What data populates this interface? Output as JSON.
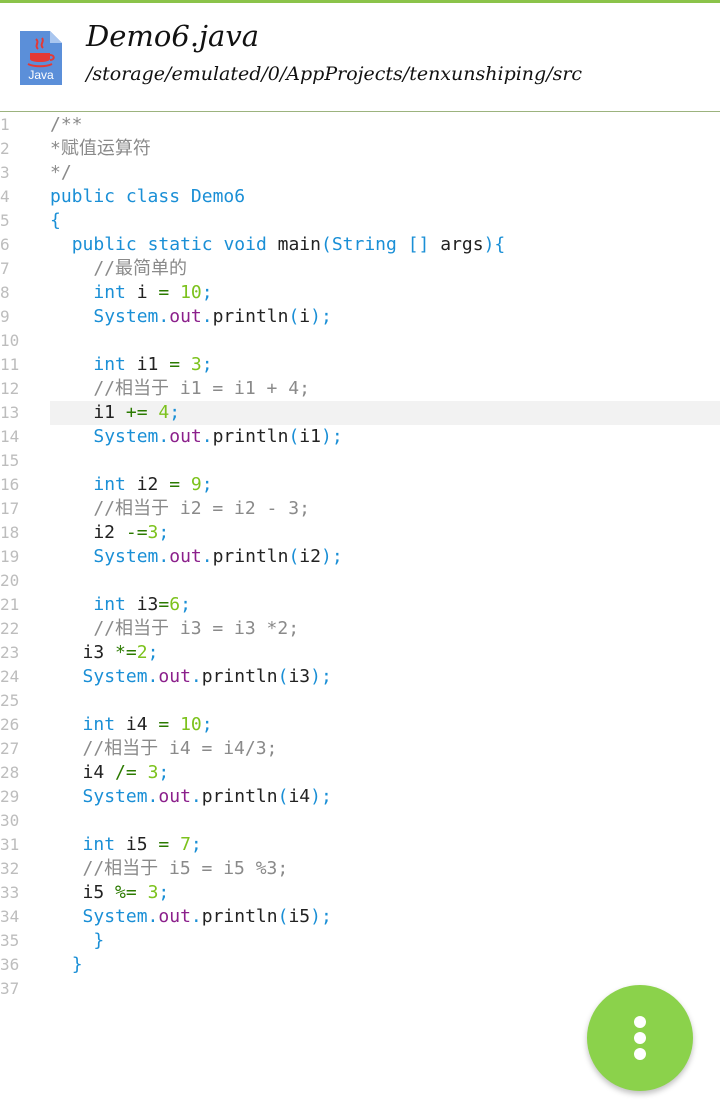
{
  "header": {
    "title": "Demo6.java",
    "path": "/storage/emulated/0/AppProjects/tenxunshiping/src",
    "file_icon_label": "Java",
    "accent": "#8bc34a"
  },
  "editor": {
    "current_line": 13,
    "line_numbers": [
      "1",
      "2",
      "3",
      "4",
      "5",
      "6",
      "7",
      "8",
      "9",
      "10",
      "11",
      "12",
      "13",
      "14",
      "15",
      "16",
      "17",
      "18",
      "19",
      "20",
      "21",
      "22",
      "23",
      "24",
      "25",
      "26",
      "27",
      "28",
      "29",
      "30",
      "31",
      "32",
      "33",
      "34",
      "35",
      "36",
      "37"
    ],
    "lines": [
      "/**",
      "*赋值运算符",
      "*/",
      "public class Demo6",
      "{",
      "  public static void main(String [] args){",
      "    //最简单的",
      "    int i = 10;",
      "    System.out.println(i);",
      "",
      "    int i1 = 3;",
      "    //相当于 i1 = i1 + 4;",
      "    i1 += 4;",
      "    System.out.println(i1);",
      "",
      "    int i2 = 9;",
      "    //相当于 i2 = i2 - 3;",
      "    i2 -=3;",
      "    System.out.println(i2);",
      "",
      "    int i3=6;",
      "    //相当于 i3 = i3 *2;",
      "   i3 *=2;",
      "   System.out.println(i3);",
      "",
      "   int i4 = 10;",
      "   //相当于 i4 = i4/3;",
      "   i4 /= 3;",
      "   System.out.println(i4);",
      "",
      "   int i5 = 7;",
      "   //相当于 i5 = i5 %3;",
      "   i5 %= 3;",
      "   System.out.println(i5);",
      "    }",
      "  }",
      ""
    ]
  },
  "fab": {
    "icon": "more-vert-icon",
    "color": "#8bd24b"
  }
}
